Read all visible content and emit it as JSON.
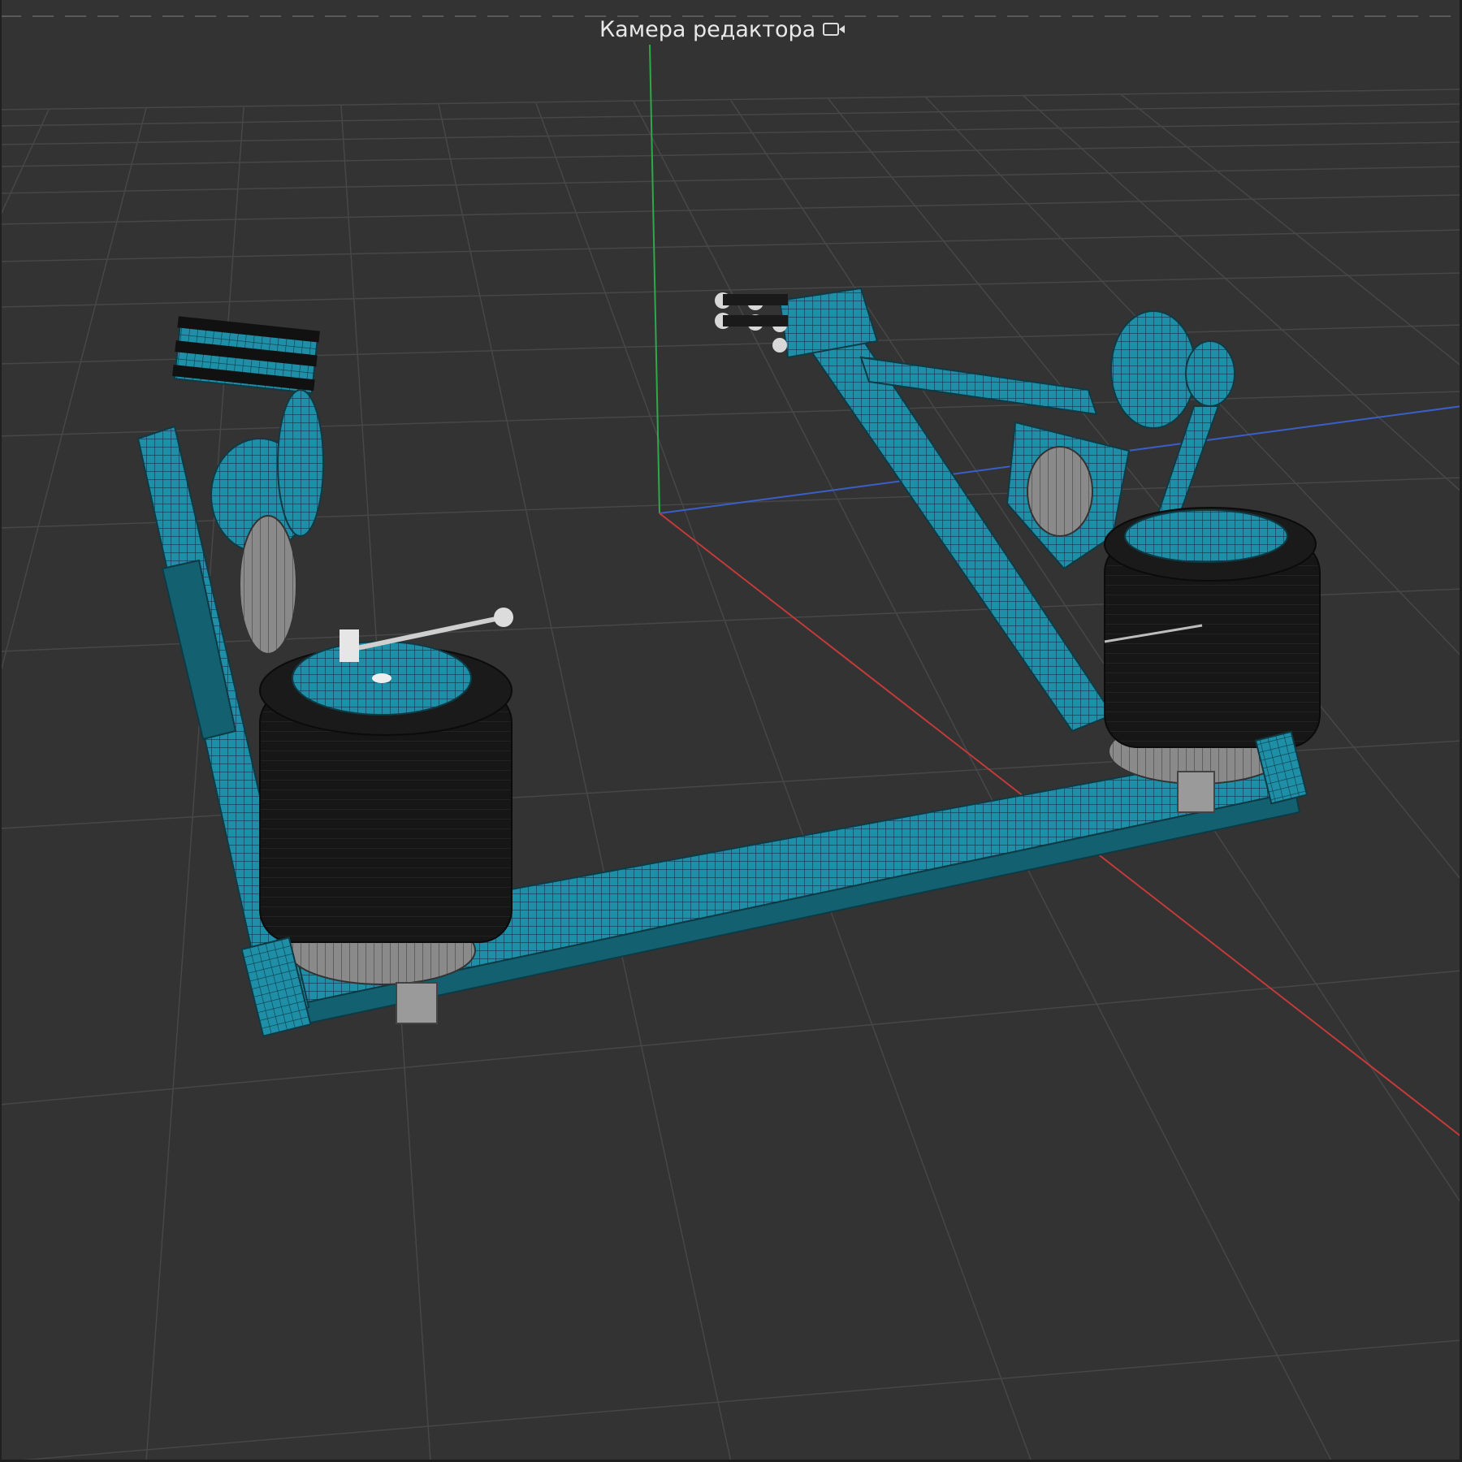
{
  "viewport": {
    "camera_label": "Камера редактора",
    "camera_icon": "camera-icon",
    "background_color": "#333333",
    "grid_color": "#3e3e3e",
    "grid_major_color": "#555555",
    "axis_colors": {
      "x": "#c23a3a",
      "y": "#2fa84a",
      "z": "#3a5fc8"
    },
    "model_color": "#1f8fa8",
    "model_dark_color": "#141414"
  }
}
